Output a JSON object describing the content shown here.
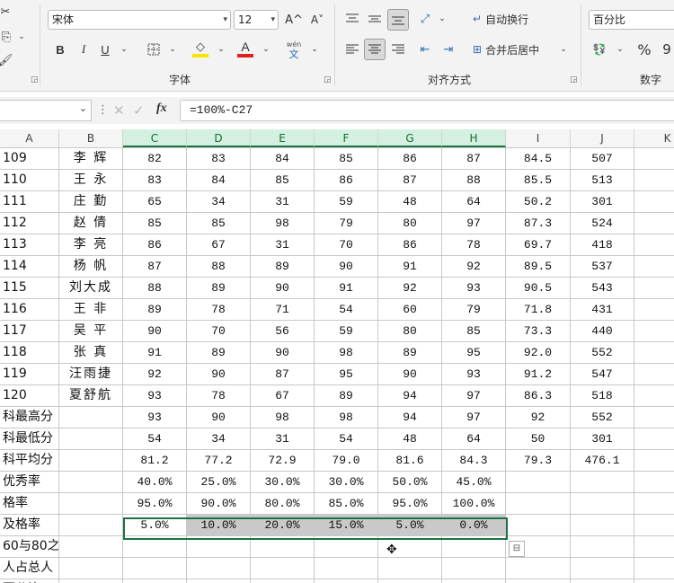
{
  "ribbon": {
    "font_name": "宋体",
    "font_size": "12",
    "grow_font": "A^",
    "shrink_font": "A˅",
    "bold": "B",
    "italic": "I",
    "underline": "U",
    "font_color_glyph": "A",
    "wen_glyph": "wén",
    "wen_sub": "文",
    "font_group_label": "字体",
    "wrap_text": "自动换行",
    "merge_center": "合并后居中",
    "align_group_label": "对齐方式",
    "number_format": "百分比",
    "percent": "%",
    "comma": "9",
    "number_group_label": "数字",
    "accent_font_color": "#e02020",
    "accent_fill_color": "#f7e600"
  },
  "formula_bar": {
    "fx": "fx",
    "formula": "=100%-C27"
  },
  "grid": {
    "columns": [
      "A",
      "B",
      "C",
      "D",
      "E",
      "F",
      "G",
      "H",
      "I",
      "J",
      "K"
    ],
    "selected_columns": [
      "C",
      "D",
      "E",
      "F",
      "G",
      "H"
    ],
    "rows": [
      {
        "a": "109",
        "b": "李 辉",
        "c": "82",
        "d": "83",
        "e": "84",
        "f": "85",
        "g": "86",
        "h": "87",
        "i": "84.5",
        "j": "507"
      },
      {
        "a": "110",
        "b": "王 永",
        "c": "83",
        "d": "84",
        "e": "85",
        "f": "86",
        "g": "87",
        "h": "88",
        "i": "85.5",
        "j": "513"
      },
      {
        "a": "111",
        "b": "庄 勤",
        "c": "65",
        "d": "34",
        "e": "31",
        "f": "59",
        "g": "48",
        "h": "64",
        "i": "50.2",
        "j": "301"
      },
      {
        "a": "112",
        "b": "赵 倩",
        "c": "85",
        "d": "85",
        "e": "98",
        "f": "79",
        "g": "80",
        "h": "97",
        "i": "87.3",
        "j": "524"
      },
      {
        "a": "113",
        "b": "李 亮",
        "c": "86",
        "d": "67",
        "e": "31",
        "f": "70",
        "g": "86",
        "h": "78",
        "i": "69.7",
        "j": "418"
      },
      {
        "a": "114",
        "b": "杨 帆",
        "c": "87",
        "d": "88",
        "e": "89",
        "f": "90",
        "g": "91",
        "h": "92",
        "i": "89.5",
        "j": "537"
      },
      {
        "a": "115",
        "b": "刘大成",
        "c": "88",
        "d": "89",
        "e": "90",
        "f": "91",
        "g": "92",
        "h": "93",
        "i": "90.5",
        "j": "543"
      },
      {
        "a": "116",
        "b": "王 非",
        "c": "89",
        "d": "78",
        "e": "71",
        "f": "54",
        "g": "60",
        "h": "79",
        "i": "71.8",
        "j": "431"
      },
      {
        "a": "117",
        "b": "吴 平",
        "c": "90",
        "d": "70",
        "e": "56",
        "f": "59",
        "g": "80",
        "h": "85",
        "i": "73.3",
        "j": "440"
      },
      {
        "a": "118",
        "b": "张 真",
        "c": "91",
        "d": "89",
        "e": "90",
        "f": "98",
        "g": "89",
        "h": "95",
        "i": "92.0",
        "j": "552"
      },
      {
        "a": "119",
        "b": "汪雨捷",
        "c": "92",
        "d": "90",
        "e": "87",
        "f": "95",
        "g": "90",
        "h": "93",
        "i": "91.2",
        "j": "547"
      },
      {
        "a": "120",
        "b": "夏舒航",
        "c": "93",
        "d": "78",
        "e": "67",
        "f": "89",
        "g": "94",
        "h": "97",
        "i": "86.3",
        "j": "518"
      },
      {
        "a": "科最高分",
        "b": "",
        "c": "93",
        "d": "90",
        "e": "98",
        "f": "98",
        "g": "94",
        "h": "97",
        "i": "92",
        "j": "552"
      },
      {
        "a": "科最低分",
        "b": "",
        "c": "54",
        "d": "34",
        "e": "31",
        "f": "54",
        "g": "48",
        "h": "64",
        "i": "50",
        "j": "301"
      },
      {
        "a": "科平均分",
        "b": "",
        "c": "81.2",
        "d": "77.2",
        "e": "72.9",
        "f": "79.0",
        "g": "81.6",
        "h": "84.3",
        "i": "79.3",
        "j": "476.1"
      },
      {
        "a": "优秀率",
        "b": "",
        "c": "40.0%",
        "d": "25.0%",
        "e": "30.0%",
        "f": "30.0%",
        "g": "50.0%",
        "h": "45.0%",
        "i": "",
        "j": ""
      },
      {
        "a": "格率",
        "b": "",
        "c": "95.0%",
        "d": "90.0%",
        "e": "80.0%",
        "f": "85.0%",
        "g": "95.0%",
        "h": "100.0%",
        "i": "",
        "j": ""
      },
      {
        "a": "及格率",
        "b": "",
        "c": "5.0%",
        "d": "10.0%",
        "e": "20.0%",
        "f": "15.0%",
        "g": "5.0%",
        "h": "0.0%",
        "i": "",
        "j": ""
      },
      {
        "a": "60与80之",
        "b": "",
        "c": "",
        "d": "",
        "e": "",
        "f": "",
        "g": "",
        "h": "",
        "i": "",
        "j": ""
      },
      {
        "a": "人占总人",
        "b": "",
        "c": "",
        "d": "",
        "e": "",
        "f": "",
        "g": "",
        "h": "",
        "i": "",
        "j": ""
      },
      {
        "a": "百分比",
        "b": "",
        "c": "",
        "d": "",
        "e": "",
        "f": "",
        "g": "",
        "h": "",
        "i": "",
        "j": ""
      }
    ]
  }
}
